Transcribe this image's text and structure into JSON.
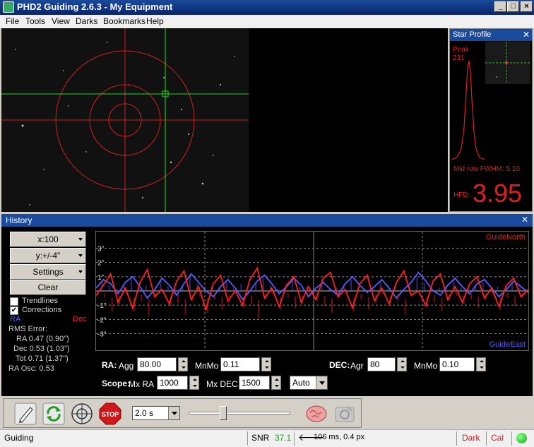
{
  "window": {
    "title": "PHD2 Guiding 2.6.3 - My Equipment"
  },
  "menu": [
    "File",
    "Tools",
    "View",
    "Darks",
    "Bookmarks",
    "Help"
  ],
  "star_profile": {
    "title": "Star Profile",
    "peak_label": "Peak",
    "peak_value": "231",
    "fwhm": "Mid row FWHM: 5.10",
    "hfd_label": "HFD:",
    "hfd_value": "3.95"
  },
  "history": {
    "title": "History",
    "x_scale": "x:100",
    "y_scale": "y:+/-4\"",
    "settings_label": "Settings",
    "clear_label": "Clear",
    "trendlines_label": "Trendlines",
    "trendlines_checked": false,
    "corrections_label": "Corrections",
    "corrections_checked": true,
    "ra_legend": "RA",
    "dec_legend": "Dec",
    "rms_title": "RMS Error:",
    "rms_ra": "RA 0.47 (0.90\")",
    "rms_dec": "Dec 0.53 (1.03\")",
    "rms_tot": "Tot 0.71 (1.37\")",
    "ra_osc": "RA Osc: 0.53",
    "y_ticks": [
      "3\"",
      "2\"",
      "1\"",
      "-1\"",
      "-2\"",
      "-3\""
    ],
    "guide_north": "GuideNorth",
    "guide_east": "GuideEast",
    "colors": {
      "ra": "#5a5aff",
      "dec": "#ff2020"
    }
  },
  "params": {
    "ra_label": "RA:",
    "ra_agg_label": "Agg",
    "ra_agg": "80.00",
    "ra_mnmo_label": "MnMo",
    "ra_mnmo": "0.11",
    "dec_label": "DEC:",
    "dec_agr_label": "Agr",
    "dec_agr": "80",
    "dec_mnmo_label": "MnMo",
    "dec_mnmo": "0.10",
    "scope_label": "Scope:",
    "mxra_label": "Mx RA",
    "mxra": "1000",
    "mxdec_label": "Mx DEC",
    "mxdec": "1500",
    "dec_mode": "Auto"
  },
  "toolbar": {
    "exposure": "2.0 s",
    "stop_label": "STOP"
  },
  "status": {
    "state": "Guiding",
    "snr_label": "SNR",
    "snr_value": "37.1",
    "guide_info": "106 ms, 0.4 px",
    "dark_label": "Dark",
    "cal_label": "Cal"
  },
  "chart_data": {
    "type": "line",
    "title": "",
    "xlabel": "",
    "ylabel": "",
    "ylim": [
      -4,
      4
    ],
    "series": [
      {
        "values": [
          0.2,
          0.8,
          0.5,
          -0.2,
          0.6,
          1.0,
          0.3,
          -0.5,
          0.1,
          0.9,
          0.4,
          -0.3,
          0.5,
          1.2,
          0.6,
          0.0,
          -0.4,
          0.3,
          0.8,
          0.2,
          -0.6,
          0.0,
          0.7,
          1.1,
          0.5,
          -0.2,
          0.3,
          0.9,
          0.4,
          -0.4,
          0.2,
          0.6,
          0.1,
          -0.3,
          0.5,
          1.0,
          0.4,
          -0.1,
          0.3,
          0.8,
          0.2,
          -0.5,
          0.1,
          0.6,
          1.3,
          0.7,
          0.0,
          -0.3,
          0.4,
          0.9,
          0.3,
          -0.2,
          0.5,
          0.8,
          0.2,
          -0.4,
          0.1,
          0.7,
          0.3,
          -0.1
        ]
      },
      {
        "values": [
          -0.3,
          0.4,
          1.2,
          -0.8,
          0.2,
          -1.2,
          0.6,
          1.5,
          -0.4,
          0.1,
          -0.9,
          0.7,
          1.4,
          -0.6,
          0.3,
          -1.3,
          0.5,
          1.1,
          -0.7,
          0.0,
          -1.0,
          0.8,
          1.6,
          -0.5,
          0.2,
          -1.1,
          0.4,
          1.0,
          -0.8,
          0.3,
          -0.6,
          0.9,
          1.3,
          -0.4,
          0.1,
          -1.2,
          0.5,
          1.1,
          -0.7,
          0.2,
          -0.9,
          0.6,
          1.4,
          -0.3,
          0.0,
          -1.0,
          0.7,
          1.2,
          -0.6,
          0.3,
          -0.8,
          0.5,
          1.0,
          -0.5,
          0.2,
          -1.1,
          0.4,
          0.9,
          -0.4,
          0.1
        ]
      }
    ]
  }
}
